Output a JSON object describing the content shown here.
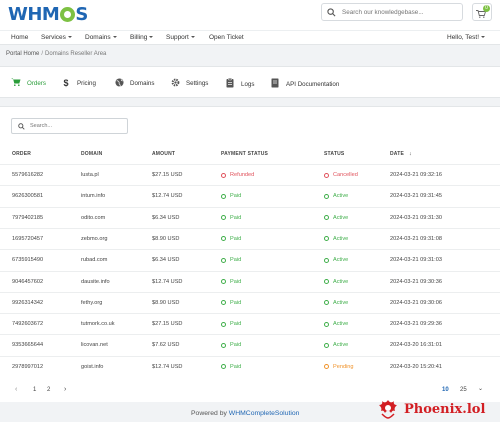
{
  "header": {
    "logo_text": "WHM",
    "logo_text_end": "S",
    "search_placeholder": "Search our knowledgebase...",
    "cart_count": "0"
  },
  "nav": {
    "items": [
      "Home",
      "Services",
      "Domains",
      "Billing",
      "Support",
      "Open Ticket"
    ],
    "user": "Hello, Test!"
  },
  "breadcrumb": {
    "home": "Portal Home",
    "sep": "/",
    "current": "Domains Reseller Area"
  },
  "tabs": [
    {
      "label": "Orders",
      "icon": "cart-icon",
      "active": true
    },
    {
      "label": "Pricing",
      "icon": "dollar-icon",
      "active": false
    },
    {
      "label": "Domains",
      "icon": "globe-icon",
      "active": false
    },
    {
      "label": "Settings",
      "icon": "gear-icon",
      "active": false
    },
    {
      "label": "Logs",
      "icon": "clipboard-icon",
      "active": false
    },
    {
      "label": "API Documentation",
      "icon": "book-icon",
      "active": false
    }
  ],
  "table": {
    "search_placeholder": "Search...",
    "columns": [
      "ORDER",
      "DOMAIN",
      "AMOUNT",
      "PAYMENT STATUS",
      "STATUS",
      "DATE"
    ],
    "sort_arrow": "↓",
    "rows": [
      {
        "order": "5579616282",
        "domain": "lusta.pl",
        "amount": "$27.15 USD",
        "payment": "Refunded",
        "payment_color": "red",
        "status": "Cancelled",
        "status_color": "red",
        "date": "2024-03-21 09:32:16"
      },
      {
        "order": "9626300581",
        "domain": "intum.info",
        "amount": "$12.74 USD",
        "payment": "Paid",
        "payment_color": "green",
        "status": "Active",
        "status_color": "green",
        "date": "2024-03-21 09:31:45"
      },
      {
        "order": "7979402185",
        "domain": "odito.com",
        "amount": "$6.34 USD",
        "payment": "Paid",
        "payment_color": "green",
        "status": "Active",
        "status_color": "green",
        "date": "2024-03-21 09:31:30"
      },
      {
        "order": "1695720457",
        "domain": "zebmo.org",
        "amount": "$8.90 USD",
        "payment": "Paid",
        "payment_color": "green",
        "status": "Active",
        "status_color": "green",
        "date": "2024-03-21 09:31:08"
      },
      {
        "order": "6735915490",
        "domain": "rubad.com",
        "amount": "$6.34 USD",
        "payment": "Paid",
        "payment_color": "green",
        "status": "Active",
        "status_color": "green",
        "date": "2024-03-21 09:31:03"
      },
      {
        "order": "9046457602",
        "domain": "dausite.info",
        "amount": "$12.74 USD",
        "payment": "Paid",
        "payment_color": "green",
        "status": "Active",
        "status_color": "green",
        "date": "2024-03-21 09:30:36"
      },
      {
        "order": "9926314342",
        "domain": "fethy.org",
        "amount": "$8.90 USD",
        "payment": "Paid",
        "payment_color": "green",
        "status": "Active",
        "status_color": "green",
        "date": "2024-03-21 09:30:06"
      },
      {
        "order": "7492603672",
        "domain": "tutmork.co.uk",
        "amount": "$27.15 USD",
        "payment": "Paid",
        "payment_color": "green",
        "status": "Active",
        "status_color": "green",
        "date": "2024-03-21 09:29:36"
      },
      {
        "order": "9353665644",
        "domain": "licovan.net",
        "amount": "$7.62 USD",
        "payment": "Paid",
        "payment_color": "green",
        "status": "Active",
        "status_color": "green",
        "date": "2024-03-20 16:31:01"
      },
      {
        "order": "2978997012",
        "domain": "goist.info",
        "amount": "$12.74 USD",
        "payment": "Paid",
        "payment_color": "green",
        "status": "Pending",
        "status_color": "orange",
        "date": "2024-03-20 15:20:41"
      }
    ]
  },
  "pagination": {
    "prev": "‹",
    "pages": [
      "1",
      "2"
    ],
    "next": "›",
    "per_page": [
      "10",
      "25"
    ],
    "per_page_more": "⌄"
  },
  "footer": {
    "powered_by": "Powered by",
    "link": "WHMCompleteSolution"
  },
  "watermark": {
    "text": "Phoenix.lol"
  },
  "colors": {
    "brand_blue": "#1f66b3",
    "accent_green": "#7dc143",
    "active_tab_green": "#2a9d3a",
    "status_green": "#3fae4a",
    "status_red": "#e0525c",
    "status_orange": "#f0932b",
    "watermark_red": "#d21e23"
  }
}
